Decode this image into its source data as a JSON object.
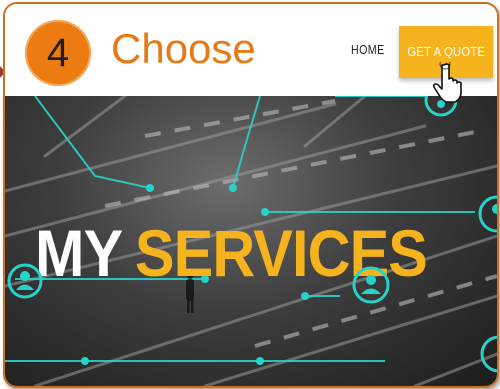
{
  "step": {
    "number": "4",
    "label": "Choose"
  },
  "nav": {
    "home": "HOME",
    "quote": "GET A QUOTE"
  },
  "hero": {
    "title_white": "MY",
    "title_yellow": "SERVICES"
  },
  "colors": {
    "accent_orange": "#ec7b12",
    "quote_yellow": "#f5b41d",
    "line_teal": "#27d3c9",
    "frame": "#c9731f"
  },
  "icons": [
    "hand-cursor-icon",
    "person-icon"
  ]
}
